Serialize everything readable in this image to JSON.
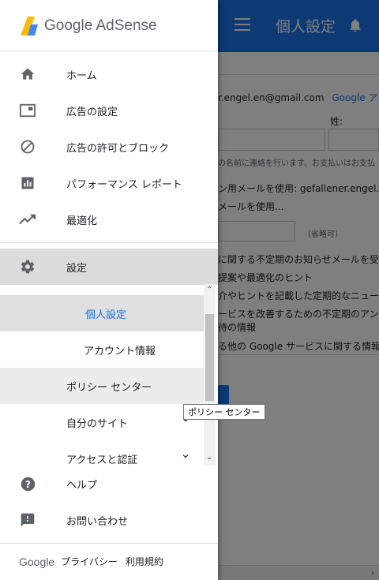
{
  "header": {
    "page_title": "個人設定"
  },
  "background": {
    "email_partial": "r.engel.en@gmail.com",
    "google_account_link": "Google アカウ",
    "surname_label": "姓:",
    "note_line": "の名前に連絡を行います。お支払いはお支払",
    "email_option1": "ン用メールを使用: gefallener.engel.en",
    "email_option2": "メールを使用...",
    "optional_label": "（省略可）",
    "pref1": "に関する不定期のお知らせメールを受け",
    "pref2": "提案や最適化のヒント",
    "pref3": "介やヒントを記載した定期的なニュース",
    "pref4": "ービスを改善するための不定期のアンケ",
    "pref5": "待の情報",
    "pref6": "る他の Google サービスに関する情報"
  },
  "drawer": {
    "brand": "Google AdSense",
    "nav": {
      "home": "ホーム",
      "ad_settings": "広告の設定",
      "allow_block": "広告の許可とブロック",
      "performance": "パフォーマンス レポート",
      "optimization": "最適化",
      "settings": "設定",
      "personal": "個人設定",
      "account_info": "アカウント情報",
      "policy_center": "ポリシー センター",
      "my_sites": "自分のサイト",
      "access_auth": "アクセスと認証",
      "help": "ヘルプ",
      "contact": "お問い合わせ"
    },
    "tooltip": "ポリシー センター",
    "footer": {
      "google": "Google",
      "privacy": "プライバシー",
      "terms": "利用規約"
    }
  },
  "colors": {
    "brand_blue": "#1a73e8",
    "logo_yellow": "#fbbc04",
    "logo_blue": "#4285f4"
  }
}
